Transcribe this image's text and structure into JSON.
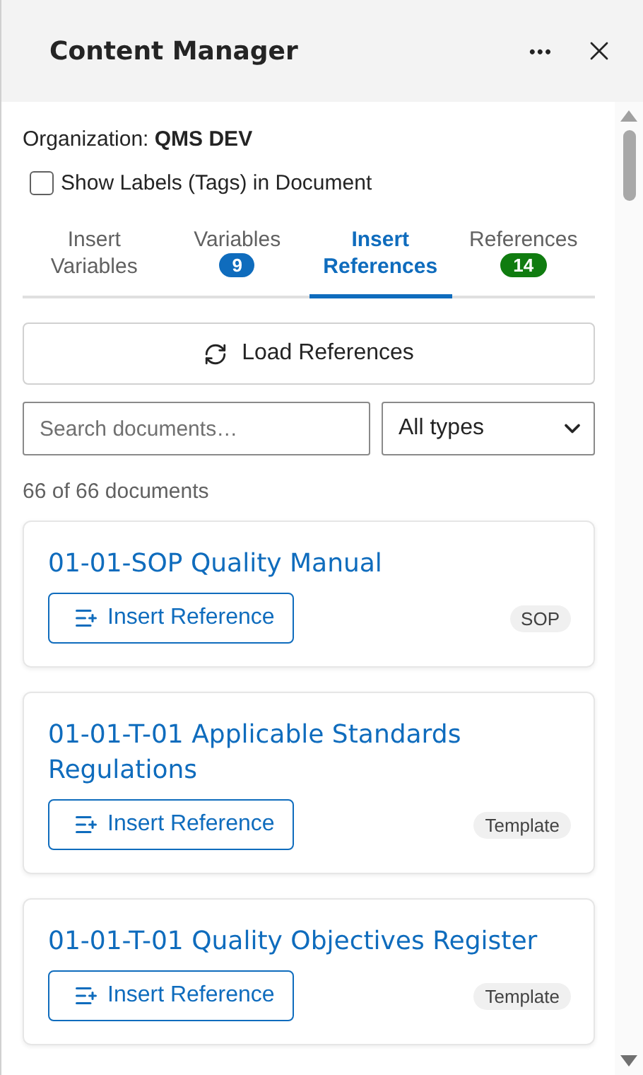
{
  "header": {
    "title": "Content Manager",
    "more": "•••"
  },
  "organization": {
    "label": "Organization:",
    "value": "QMS DEV"
  },
  "show_labels": {
    "label": "Show Labels (Tags) in Document",
    "checked": false
  },
  "tabs": [
    {
      "label": "Insert Variables",
      "selected": false
    },
    {
      "label": "Variables",
      "selected": false,
      "badge": "9",
      "color": "#0f6cbd"
    },
    {
      "label": "Insert References",
      "selected": true
    },
    {
      "label": "References",
      "selected": false,
      "badge": "14",
      "color": "#107c10"
    }
  ],
  "load_button": "Load References",
  "search": {
    "placeholder": "Search documents…"
  },
  "type_filter": {
    "value": "All types"
  },
  "count": "66 of 66 documents",
  "documents": [
    {
      "title": "01-01-SOP Quality Manual",
      "button": "Insert Reference",
      "tag": "SOP"
    },
    {
      "title": "01-01-T-01 Applicable Standards Regulations",
      "button": "Insert Reference",
      "tag": "Template"
    },
    {
      "title": "01-01-T-01 Quality Objectives Register",
      "button": "Insert Reference",
      "tag": "Template"
    }
  ]
}
